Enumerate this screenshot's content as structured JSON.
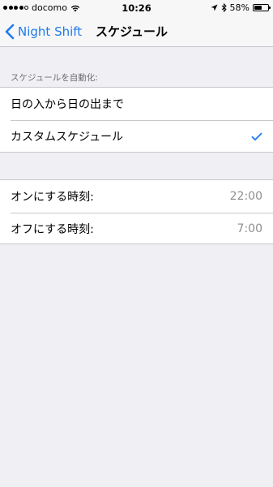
{
  "status_bar": {
    "carrier": "docomo",
    "time": "10:26",
    "battery_text": "58%",
    "battery_level": 0.58
  },
  "nav": {
    "back_label": "Night Shift",
    "title": "スケジュール"
  },
  "schedule_section": {
    "header": "スケジュールを自動化:",
    "options": [
      {
        "label": "日の入から日の出まで",
        "selected": false
      },
      {
        "label": "カスタムスケジュール",
        "selected": true
      }
    ]
  },
  "time_section": {
    "rows": [
      {
        "label": "オンにする時刻:",
        "value": "22:00"
      },
      {
        "label": "オフにする時刻:",
        "value": "7:00"
      }
    ]
  },
  "colors": {
    "accent": "#1e7bf0",
    "background": "#efeff4",
    "separator": "#c8c7cc",
    "secondary_text": "#8e8e93"
  },
  "icons": {
    "back": "chevron-left-icon",
    "check": "checkmark-icon",
    "wifi": "wifi-icon",
    "location": "location-arrow-icon",
    "bluetooth": "bluetooth-icon",
    "battery": "battery-icon"
  }
}
